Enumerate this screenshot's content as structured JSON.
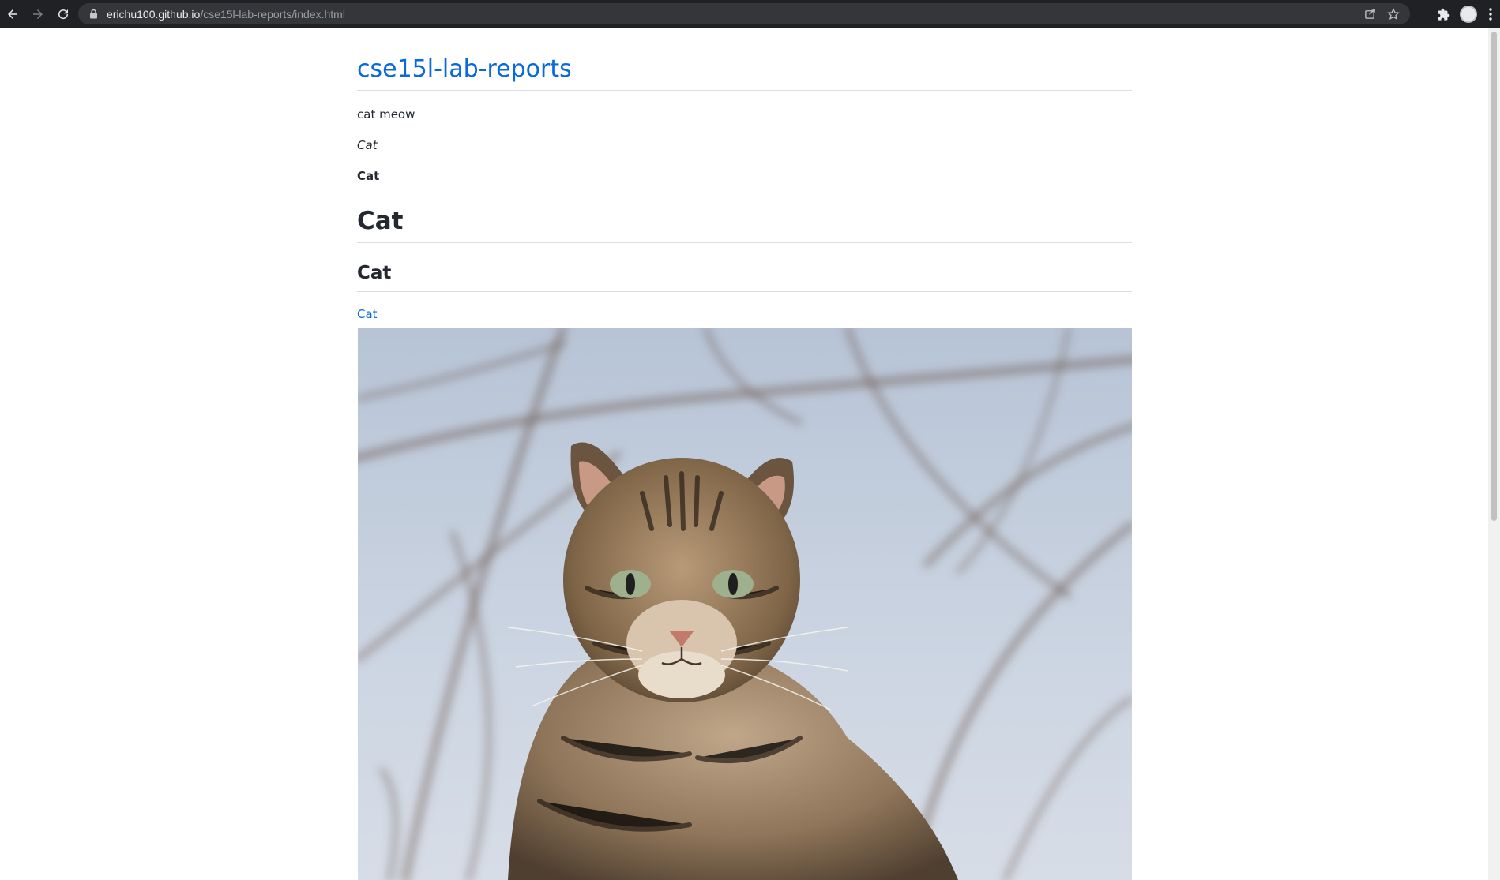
{
  "browser": {
    "url_host": "erichu100.github.io",
    "url_path": "/cse15l-lab-reports/index.html"
  },
  "page": {
    "site_title": "cse15l-lab-reports",
    "paragraph": "cat meow",
    "italic_text": "Cat",
    "bold_text": "Cat",
    "heading1": "Cat",
    "heading2": "Cat",
    "link_text": "Cat",
    "image_subject": "tabby-cat-photo"
  },
  "colors": {
    "link": "#0969da",
    "chrome_bg": "#202124",
    "omnibox_bg": "#35363a"
  }
}
